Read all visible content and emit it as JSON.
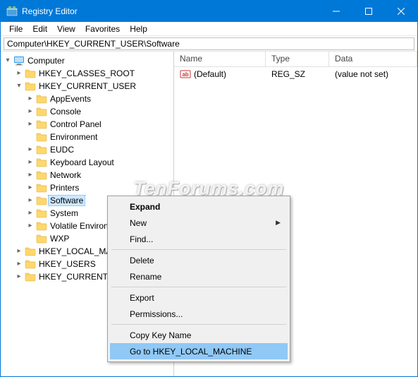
{
  "window": {
    "title": "Registry Editor"
  },
  "menubar": [
    "File",
    "Edit",
    "View",
    "Favorites",
    "Help"
  ],
  "address": "Computer\\HKEY_CURRENT_USER\\Software",
  "tree": {
    "root": "Computer",
    "hives": [
      {
        "name": "HKEY_CLASSES_ROOT",
        "expanded": false
      },
      {
        "name": "HKEY_CURRENT_USER",
        "expanded": true,
        "children": [
          "AppEvents",
          "Console",
          "Control Panel",
          "Environment",
          "EUDC",
          "Keyboard Layout",
          "Network",
          "Printers",
          "Software",
          "System",
          "Volatile Environment",
          "WXP"
        ],
        "selected": "Software"
      },
      {
        "name": "HKEY_LOCAL_MACHINE",
        "expanded": false
      },
      {
        "name": "HKEY_USERS",
        "expanded": false
      },
      {
        "name": "HKEY_CURRENT_CONFIG",
        "expanded": false
      }
    ]
  },
  "list": {
    "columns": {
      "name": "Name",
      "type": "Type",
      "data": "Data"
    },
    "rows": [
      {
        "name": "(Default)",
        "type": "REG_SZ",
        "data": "(value not set)"
      }
    ]
  },
  "context_menu": {
    "items": [
      {
        "label": "Expand",
        "bold": true
      },
      {
        "label": "New",
        "submenu": true
      },
      {
        "label": "Find..."
      },
      {
        "sep": true
      },
      {
        "label": "Delete"
      },
      {
        "label": "Rename"
      },
      {
        "sep": true
      },
      {
        "label": "Export"
      },
      {
        "label": "Permissions..."
      },
      {
        "sep": true
      },
      {
        "label": "Copy Key Name"
      },
      {
        "label": "Go to HKEY_LOCAL_MACHINE",
        "highlight": true
      }
    ]
  },
  "watermark": "TenForums.com"
}
